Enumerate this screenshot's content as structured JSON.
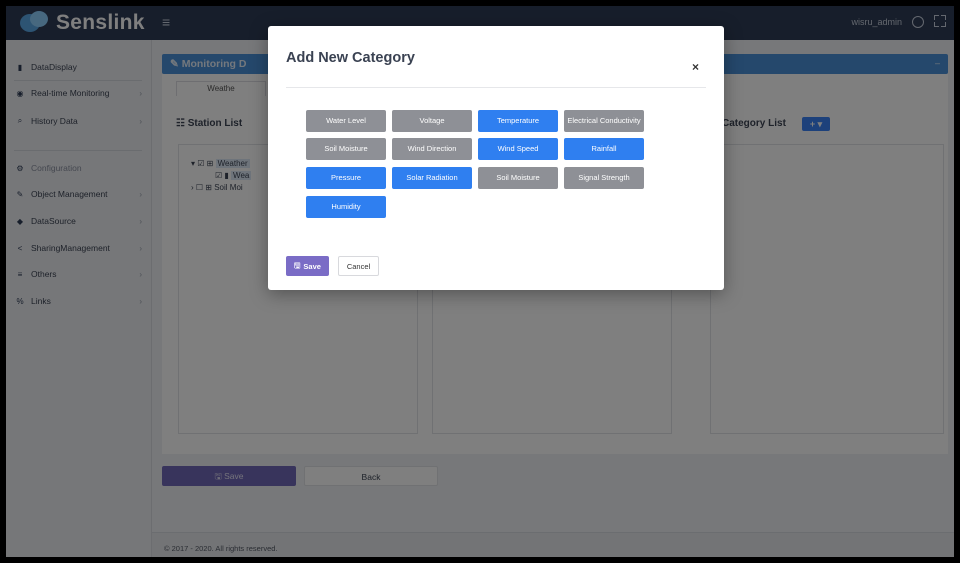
{
  "topbar": {
    "logo_text": "Senslink",
    "menu_icon": "≡",
    "user_name": "wisru_admin"
  },
  "sidebar": {
    "items": [
      {
        "icon": "chart-icon",
        "glyph": "▮",
        "label": "DataDisplay"
      },
      {
        "icon": "monitor-icon",
        "glyph": "◉",
        "label": "Real-time Monitoring"
      },
      {
        "icon": "search-icon",
        "glyph": "⌕",
        "label": "History Data"
      },
      {
        "icon": "gears-icon",
        "glyph": "⚙",
        "label": "Configuration"
      },
      {
        "icon": "wrench-icon",
        "glyph": "✎",
        "label": "Object Management"
      },
      {
        "icon": "database-icon",
        "glyph": "◆",
        "label": "DataSource"
      },
      {
        "icon": "share-icon",
        "glyph": "<",
        "label": "SharingManagement"
      },
      {
        "icon": "sliders-icon",
        "glyph": "≡",
        "label": "Others"
      },
      {
        "icon": "links-icon",
        "glyph": "%",
        "label": "Links"
      }
    ]
  },
  "main": {
    "panel_title": "Monitoring D",
    "tab_label": "Weathe",
    "station_list_title": "Station List",
    "category_list_title": "Category List",
    "add_category_label": "+ ▾",
    "tree": {
      "row1": "Weather",
      "row2": "Wea",
      "row3": "Soil Moi"
    },
    "save_label": "Save",
    "back_label": "Back",
    "footer": "© 2017 - 2020. All rights reserved."
  },
  "modal": {
    "title": "Add New Category",
    "close_label": "×",
    "save_label": "Save",
    "cancel_label": "Cancel",
    "categories": [
      {
        "label": "Water Level",
        "selected": false
      },
      {
        "label": "Voltage",
        "selected": false
      },
      {
        "label": "Temperature",
        "selected": true
      },
      {
        "label": "Electrical Conductivity",
        "selected": false
      },
      {
        "label": "Soil Moisture",
        "selected": false
      },
      {
        "label": "Wind Direction",
        "selected": false
      },
      {
        "label": "Wind Speed",
        "selected": true
      },
      {
        "label": "Rainfall",
        "selected": true
      },
      {
        "label": "Pressure",
        "selected": true
      },
      {
        "label": "Solar Radiation",
        "selected": true
      },
      {
        "label": "Soil Moisture",
        "selected": false
      },
      {
        "label": "Signal Strength",
        "selected": false
      },
      {
        "label": "Humidity",
        "selected": true
      }
    ]
  },
  "colors": {
    "selected": "#2f7ff0",
    "unselected": "#8e9096",
    "primary_purple": "#7a6cc6",
    "topbar": "#2f3d57"
  }
}
